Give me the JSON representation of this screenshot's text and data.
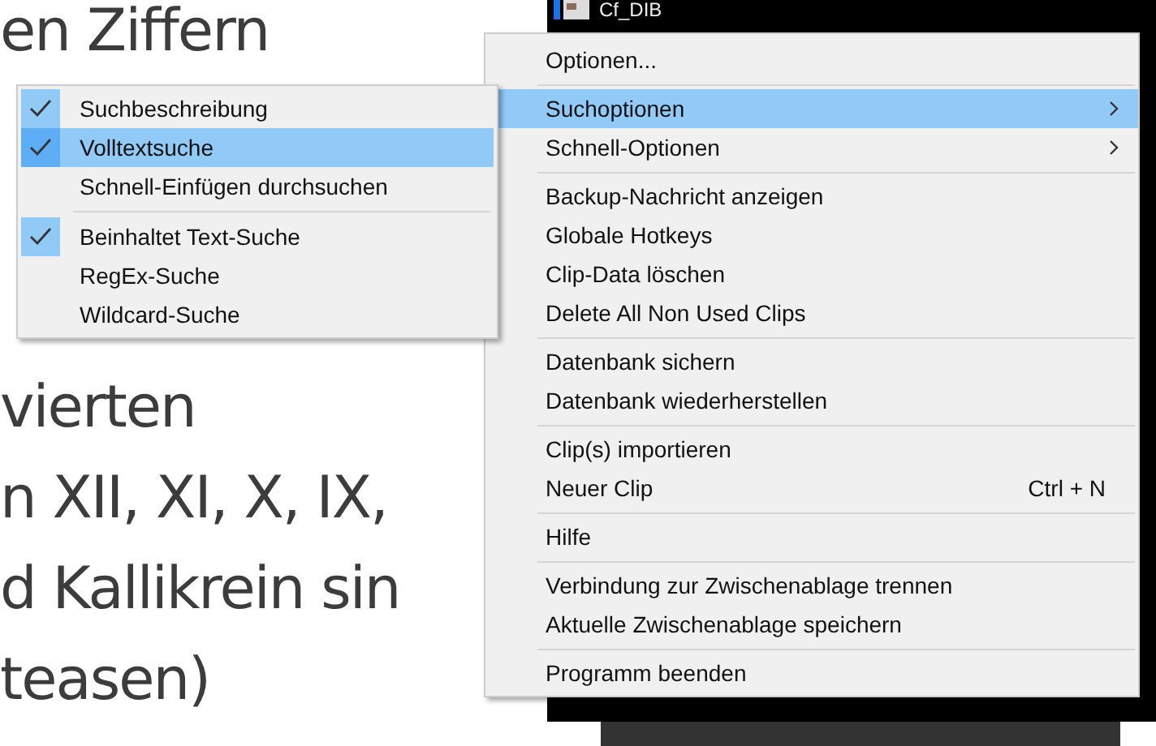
{
  "document": {
    "lines": [
      "en Ziffern",
      "vierten",
      "n XII, XI, X, IX,",
      "d Kallikrein sin",
      "teasen)"
    ]
  },
  "background_window": {
    "item_label": "Cf_DIB"
  },
  "context_menu": {
    "groups": [
      [
        {
          "label": "Optionen...",
          "selected": false,
          "has_submenu": false
        }
      ],
      [
        {
          "label": "Suchoptionen",
          "selected": true,
          "has_submenu": true
        },
        {
          "label": "Schnell-Optionen",
          "selected": false,
          "has_submenu": true
        }
      ],
      [
        {
          "label": "Backup-Nachricht anzeigen",
          "selected": false,
          "has_submenu": false
        },
        {
          "label": "Globale Hotkeys",
          "selected": false,
          "has_submenu": false
        },
        {
          "label": "Clip-Data löschen",
          "selected": false,
          "has_submenu": false
        },
        {
          "label": "Delete All Non Used Clips",
          "selected": false,
          "has_submenu": false
        }
      ],
      [
        {
          "label": "Datenbank sichern",
          "selected": false,
          "has_submenu": false
        },
        {
          "label": "Datenbank wiederherstellen",
          "selected": false,
          "has_submenu": false
        }
      ],
      [
        {
          "label": "Clip(s) importieren",
          "selected": false,
          "has_submenu": false
        },
        {
          "label": "Neuer Clip",
          "selected": false,
          "has_submenu": false,
          "shortcut": "Ctrl + N"
        }
      ],
      [
        {
          "label": "Hilfe",
          "selected": false,
          "has_submenu": false
        }
      ],
      [
        {
          "label": "Verbindung zur Zwischenablage trennen",
          "selected": false,
          "has_submenu": false
        },
        {
          "label": "Aktuelle Zwischenablage speichern",
          "selected": false,
          "has_submenu": false
        }
      ],
      [
        {
          "label": "Programm beenden",
          "selected": false,
          "has_submenu": false
        }
      ]
    ]
  },
  "submenu": {
    "groups": [
      [
        {
          "label": "Suchbeschreibung",
          "checked": true,
          "selected": false
        },
        {
          "label": "Volltextsuche",
          "checked": true,
          "selected": true
        },
        {
          "label": "Schnell-Einfügen durchsuchen",
          "checked": false,
          "selected": false
        }
      ],
      [
        {
          "label": "Beinhaltet Text-Suche",
          "checked": true,
          "selected": false
        },
        {
          "label": "RegEx-Suche",
          "checked": false,
          "selected": false
        },
        {
          "label": "Wildcard-Suche",
          "checked": false,
          "selected": false
        }
      ]
    ]
  }
}
